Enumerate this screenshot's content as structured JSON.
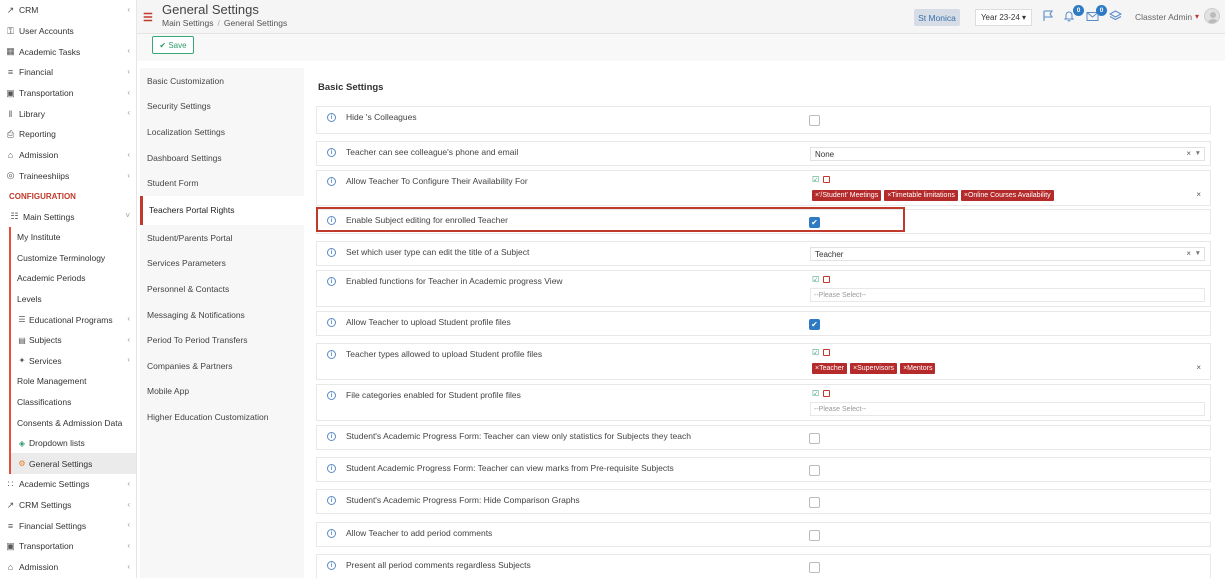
{
  "sidebar": {
    "top_items": [
      {
        "label": "CRM",
        "icon": "chart-icon",
        "chevron": true
      },
      {
        "label": "User Accounts",
        "icon": "key-icon",
        "chevron": false
      },
      {
        "label": "Academic Tasks",
        "icon": "grid-icon",
        "chevron": true
      },
      {
        "label": "Financial",
        "icon": "ledger-icon",
        "chevron": true
      },
      {
        "label": "Transportation",
        "icon": "bus-icon",
        "chevron": true
      },
      {
        "label": "Library",
        "icon": "books-icon",
        "chevron": true
      },
      {
        "label": "Reporting",
        "icon": "printer-icon",
        "chevron": false
      },
      {
        "label": "Admission",
        "icon": "bank-icon",
        "chevron": true
      },
      {
        "label": "Traineeshiips",
        "icon": "globe-icon",
        "chevron": true
      }
    ],
    "section_label": "CONFIGURATION",
    "main_settings_label": "Main Settings",
    "sub_items": [
      {
        "label": "My Institute",
        "chevron": false
      },
      {
        "label": "Customize Terminology",
        "chevron": false
      },
      {
        "label": "Academic Periods",
        "chevron": false
      },
      {
        "label": "Levels",
        "chevron": false
      },
      {
        "label": "Educational Programs",
        "chevron": true,
        "icon": "list-icon"
      },
      {
        "label": "Subjects",
        "chevron": true,
        "icon": "book-icon"
      },
      {
        "label": "Services",
        "chevron": true,
        "icon": "services-icon"
      },
      {
        "label": "Role Management",
        "chevron": false
      },
      {
        "label": "Classifications",
        "chevron": false
      },
      {
        "label": "Consents & Admission Data",
        "chevron": false
      },
      {
        "label": "Dropdown lists",
        "chevron": false,
        "icon": "layers-icon"
      },
      {
        "label": "General Settings",
        "chevron": false,
        "icon": "gear-icon",
        "active": true
      }
    ],
    "bottom_items": [
      {
        "label": "Academic Settings",
        "icon": "users-icon",
        "chevron": true
      },
      {
        "label": "CRM Settings",
        "icon": "chart-icon",
        "chevron": true
      },
      {
        "label": "Financial Settings",
        "icon": "ledger-icon",
        "chevron": true
      },
      {
        "label": "Transportation",
        "icon": "bus-icon",
        "chevron": true
      },
      {
        "label": "Admission",
        "icon": "bank-icon",
        "chevron": true
      }
    ]
  },
  "header": {
    "title": "General Settings",
    "breadcrumb": [
      "Main Settings",
      "General Settings"
    ],
    "school": "St Monica",
    "year": "Year 23-24",
    "notifications_count": "0",
    "messages_count": "0",
    "user_name": "Classter Admin"
  },
  "toolbar": {
    "save_label": "Save"
  },
  "settings_nav": [
    "Basic Customization",
    "Security Settings",
    "Localization Settings",
    "Dashboard Settings",
    "Student Form",
    "Teachers Portal Rights",
    "Student/Parents Portal",
    "Services Parameters",
    "Personnel & Contacts",
    "Messaging & Notifications",
    "Period To Period Transfers",
    "Companies & Partners",
    "Mobile App",
    "Higher Education Customization"
  ],
  "settings_nav_active": "Teachers Portal Rights",
  "main": {
    "section_title": "Basic Settings",
    "rows": [
      {
        "label": "Hide 's Colleagues",
        "control": "checkbox",
        "checked": false
      },
      {
        "label": "Teacher can see colleague's phone and email",
        "control": "select",
        "value": "None"
      },
      {
        "label": "Allow Teacher To Configure Their Availability For",
        "control": "tags",
        "tags": [
          "'/Student' Meetings",
          "Timetable limitations",
          "Online Courses Availability"
        ]
      },
      {
        "label": "Enable Subject editing for enrolled Teacher",
        "control": "checkbox",
        "checked": true
      },
      {
        "label": "Set which user type can edit the title of a Subject",
        "control": "select",
        "value": "Teacher"
      },
      {
        "label": "Enabled functions for Teacher in Academic progress View",
        "control": "multiselect",
        "placeholder": "--Please Select--"
      },
      {
        "label": "Allow Teacher to upload Student profile files",
        "control": "checkbox",
        "checked": true
      },
      {
        "label": "Teacher types allowed to upload  Student profile files",
        "control": "tags",
        "tags": [
          "Teacher",
          "Supervisors",
          "Mentors"
        ]
      },
      {
        "label": "File categories enabled for Student profile files",
        "control": "multiselect",
        "placeholder": "--Please Select--"
      },
      {
        "label": "Student's Academic Progress Form: Teacher can view only statistics for Subjects they teach",
        "control": "checkbox",
        "checked": false
      },
      {
        "label": "Student Academic Progress Form: Teacher can view marks from Pre-requisite Subjects",
        "control": "checkbox",
        "checked": false
      },
      {
        "label": "Student's Academic Progress Form: Hide Comparison Graphs",
        "control": "checkbox",
        "checked": false
      },
      {
        "label": "Allow Teacher to add period comments",
        "control": "checkbox",
        "checked": false
      },
      {
        "label": "Present all period comments regardless Subjects",
        "control": "checkbox",
        "checked": false
      }
    ]
  }
}
